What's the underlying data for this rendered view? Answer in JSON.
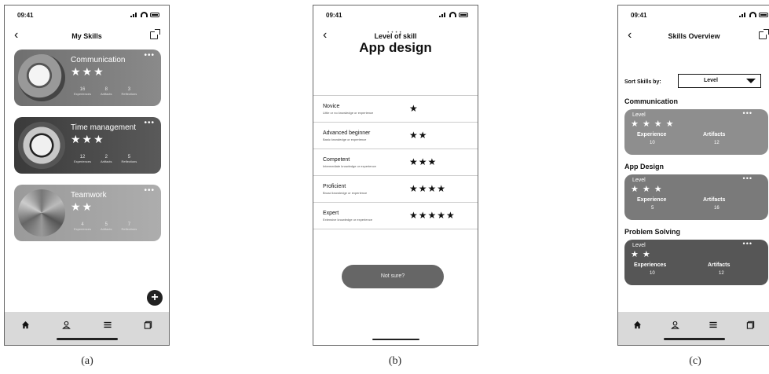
{
  "status": {
    "time": "09:41"
  },
  "captions": [
    "(a)",
    "(b)",
    "(c)"
  ],
  "screen_a": {
    "title": "My Skills",
    "cards": [
      {
        "name": "Communication",
        "stars": "★★★",
        "dots": "•••",
        "stats": [
          {
            "num": "16",
            "label": "Experiences"
          },
          {
            "num": "8",
            "label": "Artifacts"
          },
          {
            "num": "3",
            "label": "Reflections"
          }
        ]
      },
      {
        "name": "Time management",
        "stars": "★★★",
        "dots": "•••",
        "stats": [
          {
            "num": "12",
            "label": "Experiences"
          },
          {
            "num": "2",
            "label": "Artifacts"
          },
          {
            "num": "5",
            "label": "Reflections"
          }
        ]
      },
      {
        "name": "Teamwork",
        "stars": "★★",
        "dots": "•••",
        "stats": [
          {
            "num": "4",
            "label": "Experiences"
          },
          {
            "num": "5",
            "label": "Artifacts"
          },
          {
            "num": "7",
            "label": "Reflections"
          }
        ]
      }
    ],
    "add_label": "+"
  },
  "screen_b": {
    "title": "Level of skill",
    "page_dots": "••••",
    "skill": "App design",
    "levels": [
      {
        "name": "Novice",
        "desc": "Little or no knowledge or experience",
        "stars": "★"
      },
      {
        "name": "Advanced beginner",
        "desc": "Basic knowledge or experience",
        "stars": "★★"
      },
      {
        "name": "Competent",
        "desc": "Intermediate knowledge or experience",
        "stars": "★★★"
      },
      {
        "name": "Proficient",
        "desc": "Broad knowledge or experience",
        "stars": "★★★★"
      },
      {
        "name": "Expert",
        "desc": "Extensive knowledge or experience",
        "stars": "★★★★★"
      }
    ],
    "not_sure": "Not sure?"
  },
  "screen_c": {
    "title": "Skills Overview",
    "sort_label": "Sort Skills by:",
    "sort_value": "Level",
    "sections": [
      {
        "title": "Communication",
        "level_label": "Level",
        "stars": "★★★★",
        "dots": "•••",
        "left_label": "Experience",
        "left_val": "10",
        "right_label": "Artifacts",
        "right_val": "12"
      },
      {
        "title": "App Design",
        "level_label": "Level",
        "stars": "★★★",
        "dots": "•••",
        "left_label": "Experience",
        "left_val": "5",
        "right_label": "Artifacts",
        "right_val": "16"
      },
      {
        "title": "Problem Solving",
        "level_label": "Level",
        "stars": "★★",
        "dots": "•••",
        "left_label": "Experiences",
        "left_val": "10",
        "right_label": "Artifacts",
        "right_val": "12"
      }
    ]
  },
  "colors": {
    "tabbar": "#d9d9d9",
    "card_dark": "#565656",
    "card_mid": "#7a7a7a",
    "card_light": "#8e8e8e"
  }
}
